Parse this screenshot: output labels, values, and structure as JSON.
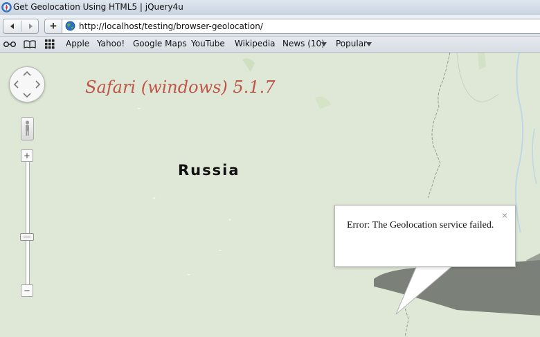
{
  "window": {
    "title": "Get Geolocation Using HTML5 | jQuery4u"
  },
  "toolbar": {
    "url": "http://localhost/testing/browser-geolocation/",
    "add_label": "+"
  },
  "bookmarks": {
    "items": [
      {
        "label": "Apple"
      },
      {
        "label": "Yahoo!"
      },
      {
        "label": "Google Maps"
      },
      {
        "label": "YouTube"
      },
      {
        "label": "Wikipedia"
      },
      {
        "label": "News (10)"
      },
      {
        "label": "Popular"
      }
    ]
  },
  "map": {
    "caption": "Safari (windows) 5.1.7",
    "country_label": "Russia",
    "zoom_in": "+",
    "zoom_out": "−",
    "zoom_level_fraction": 0.38
  },
  "infowindow": {
    "message": "Error: The Geolocation service failed.",
    "close_glyph": "×"
  },
  "colors": {
    "caption": "#bf5447",
    "map_land": "#dfe8d6",
    "border_line": "#8f9a97",
    "river": "#bcd8e6"
  }
}
